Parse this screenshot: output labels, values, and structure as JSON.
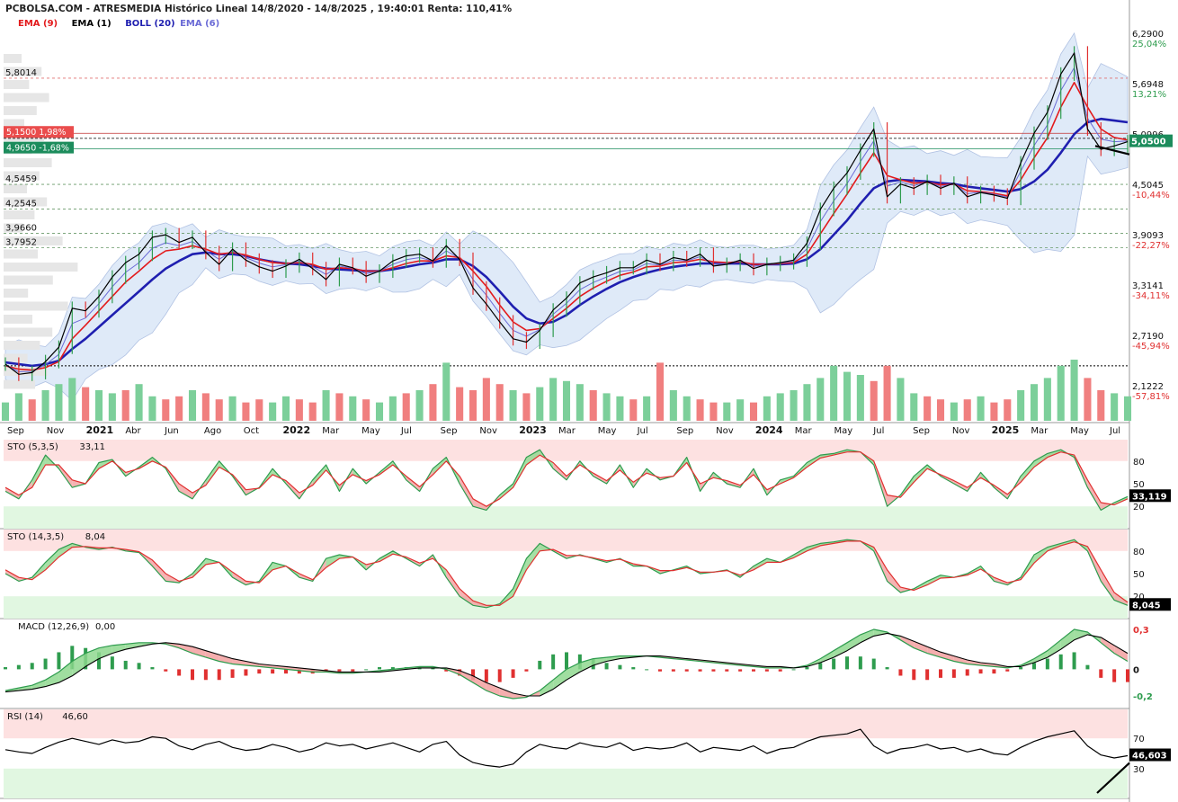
{
  "header": {
    "title": "PCBOLSA.COM - ATRESMEDIA Histórico Lineal 14/8/2020 - 14/8/2025 , 19:40:01 Renta: 110,41%",
    "legend": [
      {
        "label": "EMA (9)",
        "color": "#e31a1c"
      },
      {
        "label": "EMA (1)",
        "color": "#000000"
      },
      {
        "label": "BOLL (20)",
        "color": "#1f1fb0"
      },
      {
        "label": "EMA (6)",
        "color": "#6b6bd6"
      }
    ]
  },
  "colors": {
    "ema9": "#e31a1c",
    "price": "#000000",
    "boll_mid": "#1f1fb0",
    "ema6": "#6b6bd6",
    "band_fill": "#dce8f8",
    "green": "#2e9c4e",
    "red": "#e03030",
    "vol_green": "#7ccf9a",
    "vol_red": "#f07f7f",
    "overbought_fill": "#fde1e1",
    "oversold_fill": "#e1f7e1",
    "current_badge": "#1c8c5c",
    "red_badge": "#ea4d4d"
  },
  "chart_data": [
    {
      "type": "line",
      "name": "price",
      "x_tick_labels": [
        "Sep",
        "Nov",
        "2021",
        "Abr",
        "Jun",
        "Ago",
        "Oct",
        "2022",
        "Mar",
        "May",
        "Jul",
        "Sep",
        "Nov",
        "2023",
        "Mar",
        "May",
        "Jul",
        "Sep",
        "Nov",
        "2024",
        "Mar",
        "May",
        "Jul",
        "Sep",
        "Nov",
        "2025",
        "Mar",
        "May",
        "Jul"
      ],
      "x_tick_bold": [
        "2021",
        "2022",
        "2023",
        "2024",
        "2025"
      ],
      "x_start": "2020-08-14",
      "x_end": "2025-08-14",
      "right_axis_levels": [
        {
          "value": 6.29,
          "label": "6,2900",
          "pct": "25,04%"
        },
        {
          "value": 5.6948,
          "label": "5,6948",
          "pct": "13,21%"
        },
        {
          "value": 5.0996,
          "label": "5,0996",
          "pct": ""
        },
        {
          "value": 4.5045,
          "label": "4,5045",
          "pct": "-10,44%"
        },
        {
          "value": 3.9093,
          "label": "3,9093",
          "pct": "-22,27%"
        },
        {
          "value": 3.3141,
          "label": "3,3141",
          "pct": "-34,11%"
        },
        {
          "value": 2.719,
          "label": "2,7190",
          "pct": "-45,94%"
        },
        {
          "value": 2.1222,
          "label": "2,1222",
          "pct": "-57,81%"
        }
      ],
      "left_levels": [
        {
          "value": 5.8014,
          "label": "5,8014"
        },
        {
          "value": 4.5459,
          "label": "4,5459"
        },
        {
          "value": 4.2545,
          "label": "4,2545"
        },
        {
          "value": 3.966,
          "label": "3,9660"
        },
        {
          "value": 3.7952,
          "label": "3,7952"
        }
      ],
      "badges": [
        {
          "value": 5.15,
          "label": "5,1500  1,98%"
        },
        {
          "value": 4.965,
          "label": "4,9650  -1,68%"
        }
      ],
      "current": {
        "value": 5.05,
        "label": "5,0500"
      },
      "price": [
        2.42,
        2.3,
        2.32,
        2.45,
        2.62,
        3.08,
        3.05,
        3.22,
        3.45,
        3.62,
        3.72,
        3.92,
        3.95,
        3.86,
        3.92,
        3.74,
        3.6,
        3.78,
        3.65,
        3.57,
        3.52,
        3.58,
        3.66,
        3.55,
        3.42,
        3.6,
        3.56,
        3.46,
        3.52,
        3.64,
        3.7,
        3.72,
        3.64,
        3.82,
        3.66,
        3.32,
        3.13,
        2.92,
        2.72,
        2.68,
        2.82,
        3.06,
        3.2,
        3.38,
        3.45,
        3.5,
        3.56,
        3.56,
        3.65,
        3.6,
        3.68,
        3.65,
        3.72,
        3.58,
        3.6,
        3.65,
        3.55,
        3.6,
        3.62,
        3.65,
        3.85,
        4.25,
        4.5,
        4.68,
        4.95,
        5.2,
        4.4,
        4.55,
        4.5,
        4.58,
        4.5,
        4.56,
        4.4,
        4.45,
        4.42,
        4.38,
        4.8,
        5.15,
        5.4,
        5.85,
        6.1,
        5.2,
        4.96,
        5.0,
        5.05
      ],
      "ema9": [
        2.4,
        2.36,
        2.35,
        2.38,
        2.45,
        2.72,
        2.88,
        3.05,
        3.22,
        3.39,
        3.52,
        3.66,
        3.76,
        3.78,
        3.82,
        3.78,
        3.72,
        3.74,
        3.71,
        3.66,
        3.62,
        3.61,
        3.62,
        3.6,
        3.54,
        3.56,
        3.55,
        3.52,
        3.52,
        3.56,
        3.61,
        3.64,
        3.64,
        3.7,
        3.68,
        3.52,
        3.34,
        3.12,
        2.92,
        2.82,
        2.84,
        2.96,
        3.08,
        3.22,
        3.32,
        3.4,
        3.47,
        3.51,
        3.57,
        3.58,
        3.62,
        3.63,
        3.66,
        3.63,
        3.62,
        3.63,
        3.6,
        3.6,
        3.61,
        3.62,
        3.72,
        3.96,
        4.2,
        4.43,
        4.68,
        4.92,
        4.65,
        4.6,
        4.56,
        4.57,
        4.54,
        4.55,
        4.47,
        4.46,
        4.44,
        4.41,
        4.6,
        4.86,
        5.1,
        5.46,
        5.75,
        5.46,
        5.2,
        5.1,
        5.07
      ],
      "boll_mid": [
        2.44,
        2.42,
        2.4,
        2.42,
        2.46,
        2.6,
        2.72,
        2.86,
        3.0,
        3.14,
        3.28,
        3.42,
        3.55,
        3.64,
        3.72,
        3.74,
        3.72,
        3.72,
        3.7,
        3.66,
        3.63,
        3.61,
        3.6,
        3.58,
        3.55,
        3.54,
        3.53,
        3.52,
        3.52,
        3.54,
        3.57,
        3.6,
        3.62,
        3.66,
        3.66,
        3.58,
        3.45,
        3.28,
        3.1,
        2.96,
        2.9,
        2.92,
        3.0,
        3.12,
        3.22,
        3.31,
        3.39,
        3.45,
        3.5,
        3.54,
        3.57,
        3.59,
        3.61,
        3.61,
        3.61,
        3.61,
        3.6,
        3.6,
        3.6,
        3.61,
        3.66,
        3.78,
        3.95,
        4.12,
        4.32,
        4.5,
        4.58,
        4.6,
        4.59,
        4.58,
        4.56,
        4.55,
        4.52,
        4.5,
        4.48,
        4.46,
        4.49,
        4.58,
        4.72,
        4.92,
        5.14,
        5.28,
        5.32,
        5.3,
        5.28
      ]
    },
    {
      "type": "bar",
      "name": "volume",
      "values": [
        0.3,
        0.45,
        0.35,
        0.5,
        0.6,
        0.7,
        0.55,
        0.5,
        0.45,
        0.5,
        0.6,
        0.4,
        0.35,
        0.4,
        0.5,
        0.45,
        0.35,
        0.4,
        0.3,
        0.35,
        0.3,
        0.4,
        0.35,
        0.3,
        0.5,
        0.45,
        0.4,
        0.35,
        0.3,
        0.4,
        0.45,
        0.5,
        0.6,
        0.95,
        0.55,
        0.5,
        0.7,
        0.6,
        0.5,
        0.45,
        0.55,
        0.7,
        0.65,
        0.6,
        0.5,
        0.45,
        0.4,
        0.35,
        0.4,
        0.95,
        0.5,
        0.4,
        0.35,
        0.3,
        0.3,
        0.35,
        0.3,
        0.4,
        0.45,
        0.5,
        0.6,
        0.7,
        0.9,
        0.8,
        0.75,
        0.65,
        0.9,
        0.7,
        0.45,
        0.4,
        0.35,
        0.3,
        0.35,
        0.4,
        0.3,
        0.35,
        0.5,
        0.6,
        0.7,
        0.9,
        1.0,
        0.7,
        0.5,
        0.45,
        0.4
      ],
      "up": [
        1,
        1,
        0,
        1,
        1,
        1,
        0,
        1,
        1,
        0,
        1,
        1,
        0,
        0,
        1,
        0,
        0,
        1,
        0,
        0,
        1,
        1,
        0,
        0,
        1,
        0,
        1,
        0,
        1,
        1,
        0,
        1,
        0,
        1,
        0,
        0,
        0,
        0,
        1,
        0,
        1,
        1,
        1,
        1,
        0,
        1,
        1,
        0,
        1,
        0,
        1,
        1,
        0,
        0,
        1,
        1,
        0,
        1,
        1,
        1,
        1,
        1,
        1,
        1,
        1,
        0,
        0,
        1,
        1,
        0,
        0,
        1,
        0,
        1,
        0,
        0,
        1,
        1,
        1,
        1,
        1,
        0,
        0,
        1,
        1
      ]
    },
    {
      "type": "line",
      "name": "STO (5,3,5)",
      "label": "STO (5,3,5)",
      "value_label": "33,11",
      "current_badge": "33,119",
      "levels": [
        80,
        50,
        20
      ],
      "k": [
        40,
        30,
        55,
        88,
        70,
        45,
        50,
        78,
        82,
        60,
        72,
        85,
        70,
        40,
        30,
        55,
        80,
        60,
        35,
        45,
        70,
        50,
        30,
        55,
        75,
        40,
        70,
        50,
        65,
        80,
        55,
        40,
        70,
        85,
        50,
        20,
        15,
        35,
        50,
        85,
        95,
        70,
        55,
        80,
        60,
        50,
        75,
        45,
        70,
        55,
        60,
        85,
        40,
        65,
        50,
        45,
        70,
        35,
        55,
        60,
        78,
        88,
        90,
        95,
        92,
        75,
        20,
        35,
        60,
        75,
        60,
        50,
        40,
        65,
        45,
        30,
        60,
        80,
        90,
        95,
        85,
        45,
        15,
        25,
        33
      ],
      "d": [
        45,
        35,
        45,
        75,
        75,
        55,
        50,
        70,
        80,
        65,
        70,
        80,
        72,
        50,
        38,
        48,
        72,
        62,
        42,
        44,
        62,
        54,
        38,
        48,
        68,
        48,
        62,
        54,
        62,
        75,
        60,
        46,
        62,
        80,
        60,
        30,
        20,
        30,
        45,
        75,
        88,
        78,
        60,
        75,
        64,
        54,
        68,
        52,
        64,
        58,
        60,
        78,
        50,
        58,
        54,
        48,
        62,
        42,
        50,
        58,
        72,
        84,
        88,
        92,
        92,
        80,
        35,
        32,
        52,
        70,
        62,
        54,
        45,
        58,
        48,
        36,
        52,
        72,
        85,
        92,
        88,
        55,
        25,
        22,
        30
      ]
    },
    {
      "type": "line",
      "name": "STO (14,3,5)",
      "label": "STO (14,3,5)",
      "value_label": "8,04",
      "current_badge": "8,045",
      "levels": [
        80,
        50,
        20
      ],
      "k": [
        50,
        40,
        45,
        65,
        82,
        90,
        85,
        82,
        85,
        80,
        78,
        60,
        40,
        38,
        50,
        70,
        65,
        45,
        35,
        40,
        65,
        60,
        45,
        40,
        70,
        75,
        72,
        55,
        70,
        80,
        70,
        60,
        75,
        45,
        20,
        8,
        5,
        10,
        30,
        70,
        90,
        80,
        70,
        75,
        70,
        65,
        70,
        60,
        60,
        50,
        55,
        60,
        50,
        52,
        55,
        45,
        60,
        70,
        65,
        75,
        85,
        90,
        92,
        95,
        93,
        80,
        40,
        25,
        30,
        40,
        48,
        45,
        50,
        60,
        40,
        35,
        45,
        75,
        85,
        90,
        95,
        80,
        40,
        15,
        8
      ],
      "d": [
        55,
        45,
        42,
        55,
        72,
        85,
        86,
        84,
        84,
        82,
        79,
        68,
        50,
        40,
        45,
        62,
        65,
        52,
        40,
        38,
        55,
        60,
        50,
        42,
        58,
        70,
        72,
        62,
        66,
        76,
        72,
        64,
        70,
        55,
        30,
        14,
        8,
        8,
        20,
        55,
        80,
        82,
        74,
        74,
        71,
        67,
        69,
        63,
        60,
        54,
        54,
        58,
        52,
        52,
        54,
        48,
        55,
        65,
        65,
        71,
        80,
        87,
        90,
        93,
        93,
        85,
        55,
        32,
        28,
        35,
        44,
        45,
        48,
        56,
        45,
        38,
        42,
        64,
        80,
        87,
        92,
        86,
        55,
        25,
        12
      ]
    },
    {
      "type": "line",
      "name": "MACD (12,26,9)",
      "label": "MACD (12,26,9)",
      "value_label": "0,00",
      "axis_labels": [
        {
          "value": 0.3,
          "label": "0,3"
        },
        {
          "value": 0,
          "label": "0"
        },
        {
          "value": -0.2,
          "label": "-0,2"
        }
      ],
      "macd": [
        -0.16,
        -0.14,
        -0.12,
        -0.08,
        -0.02,
        0.06,
        0.12,
        0.16,
        0.18,
        0.19,
        0.2,
        0.2,
        0.19,
        0.16,
        0.12,
        0.09,
        0.06,
        0.04,
        0.03,
        0.02,
        0.01,
        0.0,
        -0.01,
        -0.02,
        -0.02,
        -0.03,
        -0.03,
        -0.02,
        -0.01,
        0.0,
        0.01,
        0.02,
        0.02,
        0.0,
        -0.04,
        -0.1,
        -0.16,
        -0.2,
        -0.22,
        -0.21,
        -0.16,
        -0.08,
        0.0,
        0.05,
        0.08,
        0.09,
        0.1,
        0.1,
        0.1,
        0.09,
        0.08,
        0.07,
        0.06,
        0.05,
        0.04,
        0.03,
        0.02,
        0.01,
        0.01,
        0.01,
        0.03,
        0.08,
        0.14,
        0.2,
        0.26,
        0.3,
        0.28,
        0.22,
        0.16,
        0.12,
        0.09,
        0.06,
        0.04,
        0.03,
        0.02,
        0.01,
        0.03,
        0.08,
        0.14,
        0.22,
        0.3,
        0.28,
        0.2,
        0.12,
        0.06
      ],
      "signal": [
        -0.17,
        -0.16,
        -0.15,
        -0.13,
        -0.1,
        -0.05,
        0.02,
        0.08,
        0.12,
        0.15,
        0.17,
        0.19,
        0.2,
        0.19,
        0.17,
        0.14,
        0.11,
        0.08,
        0.06,
        0.04,
        0.03,
        0.02,
        0.01,
        0.0,
        -0.01,
        -0.02,
        -0.02,
        -0.02,
        -0.02,
        -0.01,
        0.0,
        0.01,
        0.01,
        0.01,
        -0.01,
        -0.05,
        -0.1,
        -0.14,
        -0.18,
        -0.2,
        -0.2,
        -0.15,
        -0.08,
        -0.02,
        0.03,
        0.06,
        0.08,
        0.09,
        0.1,
        0.1,
        0.09,
        0.08,
        0.07,
        0.06,
        0.05,
        0.04,
        0.03,
        0.02,
        0.02,
        0.01,
        0.02,
        0.05,
        0.09,
        0.14,
        0.2,
        0.25,
        0.27,
        0.25,
        0.21,
        0.17,
        0.13,
        0.1,
        0.07,
        0.05,
        0.04,
        0.02,
        0.02,
        0.05,
        0.09,
        0.15,
        0.22,
        0.26,
        0.24,
        0.18,
        0.12
      ]
    },
    {
      "type": "line",
      "name": "RSI (14)",
      "label": "RSI (14)",
      "value_label": "46,60",
      "current_badge": "46,603",
      "levels": [
        70,
        50,
        30
      ],
      "values": [
        55,
        52,
        50,
        58,
        65,
        70,
        66,
        62,
        68,
        64,
        66,
        72,
        70,
        60,
        55,
        62,
        66,
        58,
        54,
        56,
        62,
        58,
        52,
        56,
        64,
        60,
        62,
        56,
        60,
        64,
        58,
        52,
        62,
        66,
        48,
        38,
        34,
        32,
        36,
        52,
        62,
        58,
        56,
        64,
        60,
        58,
        64,
        54,
        58,
        56,
        58,
        64,
        52,
        58,
        56,
        54,
        60,
        50,
        56,
        58,
        66,
        72,
        74,
        76,
        82,
        60,
        50,
        56,
        58,
        62,
        56,
        58,
        52,
        56,
        50,
        48,
        58,
        66,
        72,
        76,
        80,
        60,
        48,
        44,
        47
      ]
    }
  ]
}
